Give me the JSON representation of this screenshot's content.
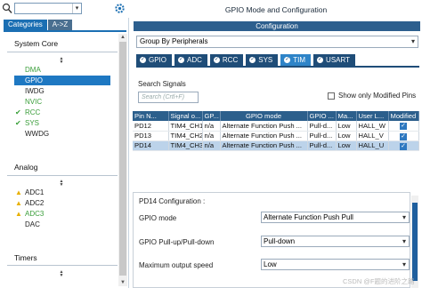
{
  "left": {
    "tabs": [
      "Categories",
      "A->Z"
    ],
    "categories": [
      {
        "name": "System Core",
        "items": [
          {
            "label": "DMA",
            "color": "green",
            "mark": ""
          },
          {
            "label": "GPIO",
            "color": "selected",
            "mark": ""
          },
          {
            "label": "IWDG",
            "color": "black",
            "mark": ""
          },
          {
            "label": "NVIC",
            "color": "green",
            "mark": ""
          },
          {
            "label": "RCC",
            "color": "green",
            "mark": "check"
          },
          {
            "label": "SYS",
            "color": "green",
            "mark": "check"
          },
          {
            "label": "WWDG",
            "color": "black",
            "mark": ""
          }
        ]
      },
      {
        "name": "Analog",
        "items": [
          {
            "label": "ADC1",
            "color": "black",
            "mark": "warn"
          },
          {
            "label": "ADC2",
            "color": "black",
            "mark": "warn"
          },
          {
            "label": "ADC3",
            "color": "green",
            "mark": "warn"
          },
          {
            "label": "DAC",
            "color": "black",
            "mark": ""
          }
        ]
      },
      {
        "name": "Timers",
        "items": []
      }
    ]
  },
  "right": {
    "title": "GPIO Mode and Configuration",
    "config_bar": "Configuration",
    "group_select": "Group By Peripherals",
    "peripheral_tabs": [
      {
        "label": "GPIO",
        "active": false
      },
      {
        "label": "ADC",
        "active": false
      },
      {
        "label": "RCC",
        "active": false
      },
      {
        "label": "SYS",
        "active": false
      },
      {
        "label": "TIM",
        "active": true
      },
      {
        "label": "USART",
        "active": false
      }
    ],
    "search_signals_label": "Search Signals",
    "search_signals_placeholder": "Search (Crtl+F)",
    "show_modified_label": "Show only Modified Pins",
    "table": {
      "headers": [
        "Pin N...",
        "Signal o...",
        "GP...",
        "GPIO mode",
        "GPIO ...",
        "Ma...",
        "User L...",
        "Modified"
      ],
      "rows": [
        {
          "pin": "PD12",
          "signal": "TIM4_CH1",
          "gp": "n/a",
          "mode": "Alternate Function Push ...",
          "pull": "Pull-d...",
          "speed": "Low",
          "label": "HALL_W",
          "modified": true,
          "selected": false
        },
        {
          "pin": "PD13",
          "signal": "TIM4_CH2",
          "gp": "n/a",
          "mode": "Alternate Function Push ...",
          "pull": "Pull-d...",
          "speed": "Low",
          "label": "HALL_V",
          "modified": true,
          "selected": false
        },
        {
          "pin": "PD14",
          "signal": "TIM4_CH3",
          "gp": "n/a",
          "mode": "Alternate Function Push ...",
          "pull": "Pull-d...",
          "speed": "Low",
          "label": "HALL_U",
          "modified": true,
          "selected": true
        }
      ]
    },
    "config_section": {
      "title": "PD14 Configuration :",
      "fields": [
        {
          "label": "GPIO mode",
          "value": "Alternate Function Push Pull"
        },
        {
          "label": "GPIO Pull-up/Pull-down",
          "value": "Pull-down"
        },
        {
          "label": "Maximum output speed",
          "value": "Low"
        }
      ]
    },
    "watermark": "CSDN @F题的进阶之路"
  }
}
